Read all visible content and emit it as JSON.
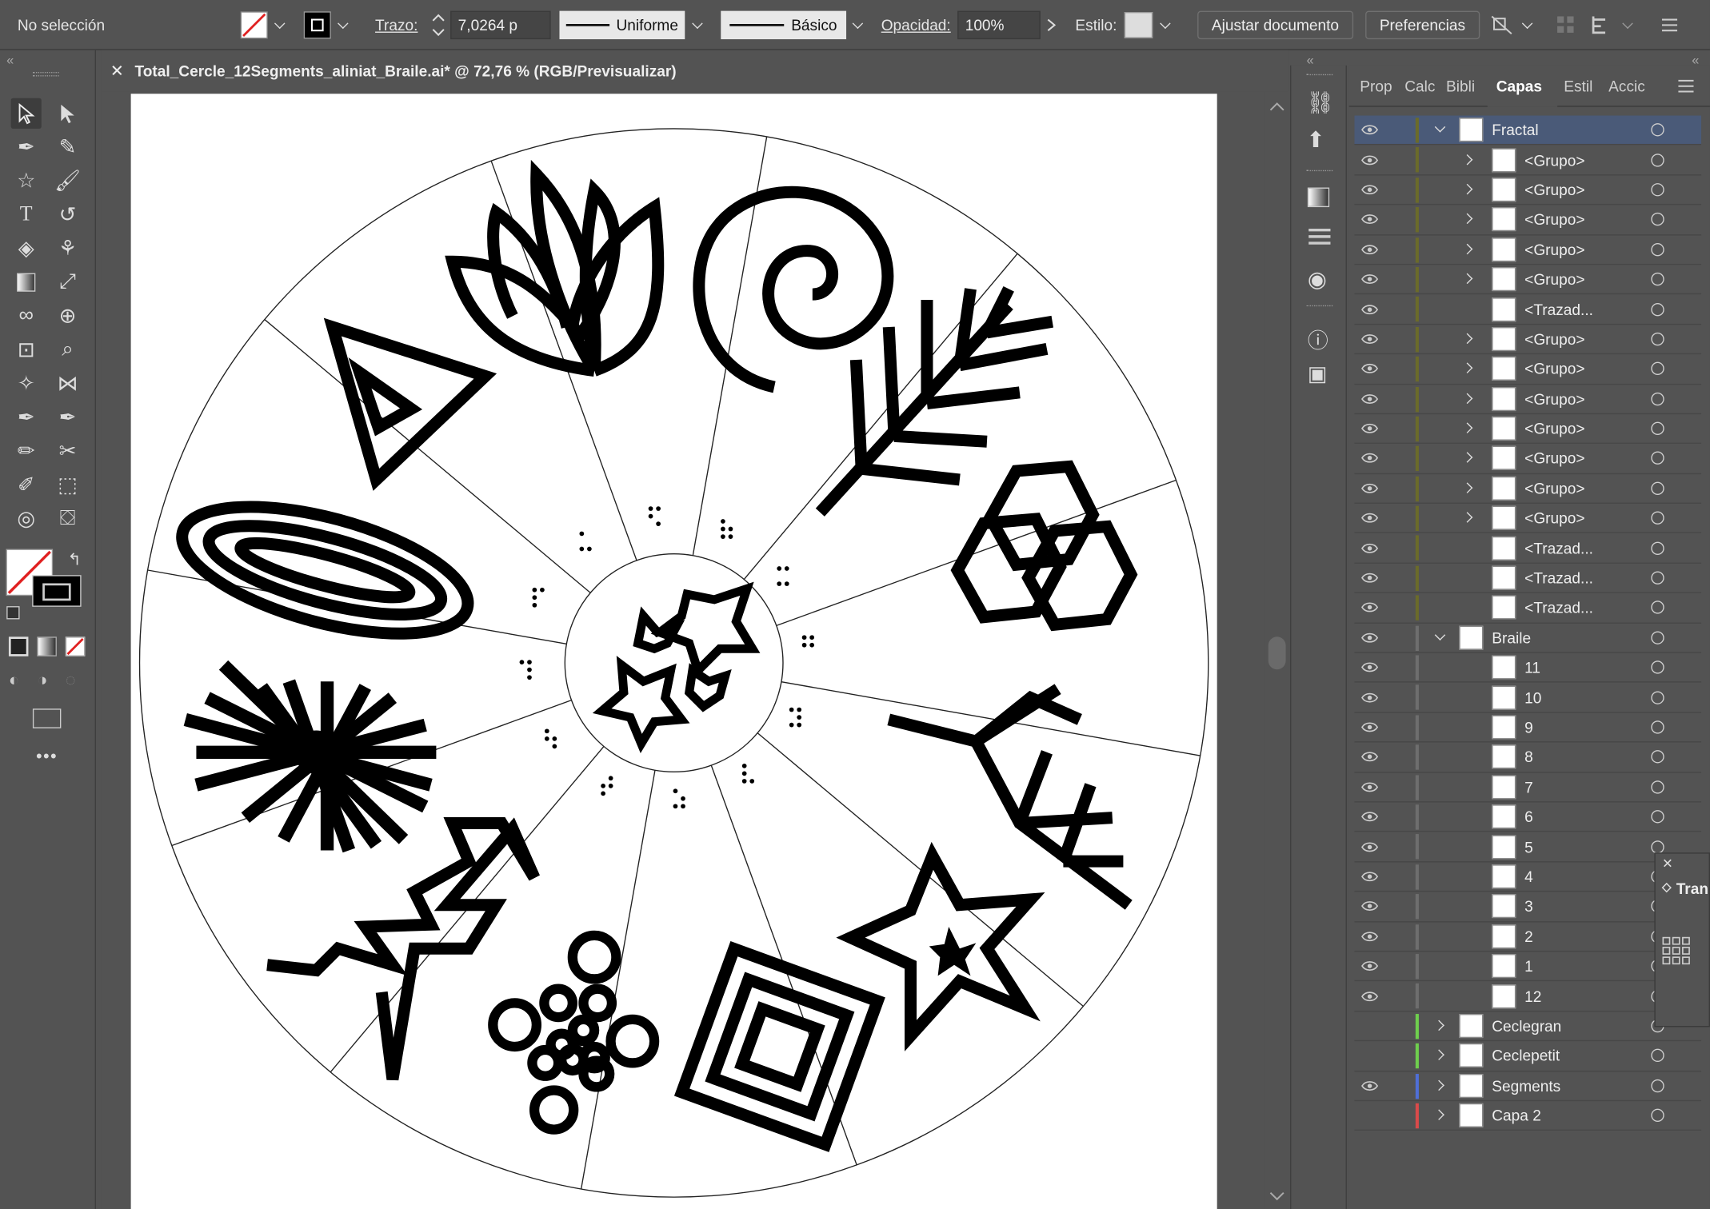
{
  "control_bar": {
    "selection": "No selección",
    "stroke_label": "Trazo:",
    "stroke_value": "7,0264 p",
    "profile": "Uniforme",
    "brush": "Básico",
    "opacity_label": "Opacidad:",
    "opacity_value": "100%",
    "style_label": "Estilo:",
    "fit_button": "Ajustar documento",
    "prefs_button": "Preferencias"
  },
  "document": {
    "tab_title": "Total_Cercle_12Segments_aliniat_Braile.ai* @ 72,76 % (RGB/Previsualizar)"
  },
  "panel": {
    "tabs": [
      "Prop",
      "Calc",
      "Bibli",
      "Capas",
      "Estil",
      "Accic"
    ],
    "active_tab": "Capas",
    "layers": [
      {
        "name": "Fractal",
        "indent": 0,
        "expanded": true,
        "bar": "#6b6b2a",
        "eye": true,
        "selected": true
      },
      {
        "name": "<Grupo>",
        "indent": 1,
        "expanded": false,
        "bar": "#6b6b2a",
        "eye": true
      },
      {
        "name": "<Grupo>",
        "indent": 1,
        "expanded": false,
        "bar": "#6b6b2a",
        "eye": true
      },
      {
        "name": "<Grupo>",
        "indent": 1,
        "expanded": false,
        "bar": "#6b6b2a",
        "eye": true
      },
      {
        "name": "<Grupo>",
        "indent": 1,
        "expanded": false,
        "bar": "#6b6b2a",
        "eye": true
      },
      {
        "name": "<Grupo>",
        "indent": 1,
        "expanded": false,
        "bar": "#6b6b2a",
        "eye": true
      },
      {
        "name": "<Trazad...",
        "indent": 1,
        "expanded": null,
        "bar": "#6b6b2a",
        "eye": true
      },
      {
        "name": "<Grupo>",
        "indent": 1,
        "expanded": false,
        "bar": "#6b6b2a",
        "eye": true
      },
      {
        "name": "<Grupo>",
        "indent": 1,
        "expanded": false,
        "bar": "#6b6b2a",
        "eye": true
      },
      {
        "name": "<Grupo>",
        "indent": 1,
        "expanded": false,
        "bar": "#6b6b2a",
        "eye": true
      },
      {
        "name": "<Grupo>",
        "indent": 1,
        "expanded": false,
        "bar": "#6b6b2a",
        "eye": true
      },
      {
        "name": "<Grupo>",
        "indent": 1,
        "expanded": false,
        "bar": "#6b6b2a",
        "eye": true
      },
      {
        "name": "<Grupo>",
        "indent": 1,
        "expanded": false,
        "bar": "#6b6b2a",
        "eye": true
      },
      {
        "name": "<Grupo>",
        "indent": 1,
        "expanded": false,
        "bar": "#6b6b2a",
        "eye": true
      },
      {
        "name": "<Trazad...",
        "indent": 1,
        "expanded": null,
        "bar": "#6b6b2a",
        "eye": true
      },
      {
        "name": "<Trazad...",
        "indent": 1,
        "expanded": null,
        "bar": "#6b6b2a",
        "eye": true
      },
      {
        "name": "<Trazad...",
        "indent": 1,
        "expanded": null,
        "bar": "#6b6b2a",
        "eye": true
      },
      {
        "name": "Braile",
        "indent": 0,
        "expanded": true,
        "bar": "#6e6e6e",
        "eye": true
      },
      {
        "name": "11",
        "indent": 1,
        "expanded": null,
        "bar": "#6e6e6e",
        "eye": true
      },
      {
        "name": "10",
        "indent": 1,
        "expanded": null,
        "bar": "#6e6e6e",
        "eye": true
      },
      {
        "name": "9",
        "indent": 1,
        "expanded": null,
        "bar": "#6e6e6e",
        "eye": true
      },
      {
        "name": "8",
        "indent": 1,
        "expanded": null,
        "bar": "#6e6e6e",
        "eye": true
      },
      {
        "name": "7",
        "indent": 1,
        "expanded": null,
        "bar": "#6e6e6e",
        "eye": true
      },
      {
        "name": "6",
        "indent": 1,
        "expanded": null,
        "bar": "#6e6e6e",
        "eye": true
      },
      {
        "name": "5",
        "indent": 1,
        "expanded": null,
        "bar": "#6e6e6e",
        "eye": true
      },
      {
        "name": "4",
        "indent": 1,
        "expanded": null,
        "bar": "#6e6e6e",
        "eye": true
      },
      {
        "name": "3",
        "indent": 1,
        "expanded": null,
        "bar": "#6e6e6e",
        "eye": true
      },
      {
        "name": "2",
        "indent": 1,
        "expanded": null,
        "bar": "#6e6e6e",
        "eye": true
      },
      {
        "name": "1",
        "indent": 1,
        "expanded": null,
        "bar": "#6e6e6e",
        "eye": true
      },
      {
        "name": "12",
        "indent": 1,
        "expanded": null,
        "bar": "#6e6e6e",
        "eye": true
      },
      {
        "name": "Ceclegran",
        "indent": 0,
        "expanded": false,
        "bar": "#6fce4d",
        "eye": false
      },
      {
        "name": "Ceclepetit",
        "indent": 0,
        "expanded": false,
        "bar": "#6fce4d",
        "eye": false
      },
      {
        "name": "Segments",
        "indent": 0,
        "expanded": false,
        "bar": "#4f6fd6",
        "eye": true
      },
      {
        "name": "Capa 2",
        "indent": 0,
        "expanded": false,
        "bar": "#d94a4a",
        "eye": false
      }
    ]
  },
  "transform_panel": {
    "title": "Tran"
  }
}
